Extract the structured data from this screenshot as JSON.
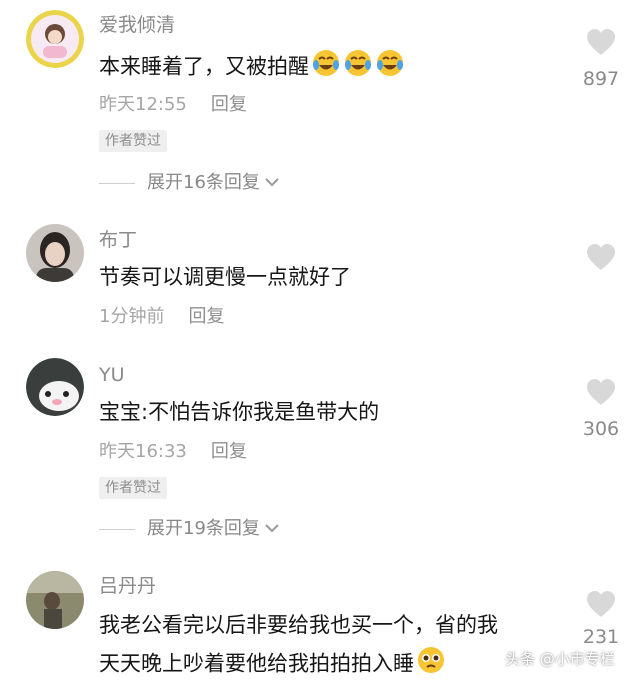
{
  "comments": [
    {
      "username": "爱我倾清",
      "text": "本来睡着了，又被拍醒",
      "time": "昨天12:55",
      "reply": "回复",
      "badge": "作者赞过",
      "expand": "展开16条回复",
      "likes": "897"
    },
    {
      "username": "布丁",
      "text": "节奏可以调更慢一点就好了",
      "time": "1分钟前",
      "reply": "回复",
      "likes": ""
    },
    {
      "username": "YU",
      "text": "宝宝:不怕告诉你我是鱼带大的",
      "time": "昨天16:33",
      "reply": "回复",
      "badge": "作者赞过",
      "expand": "展开19条回复",
      "likes": "306"
    },
    {
      "username": "吕丹丹",
      "text_line1": "我老公看完以后非要给我也买一个，省的我",
      "text_line2": "天天晚上吵着要他给我拍拍拍入睡",
      "likes": "231"
    }
  ],
  "watermark": "头条 @小市专栏",
  "colors": {
    "text": "#161616",
    "muted": "#8a8a8a",
    "heart": "#d8d8d8"
  },
  "icons": [
    "heart-icon",
    "chevron-down-icon",
    "laughing-crying-emoji",
    "pleading-emoji"
  ]
}
